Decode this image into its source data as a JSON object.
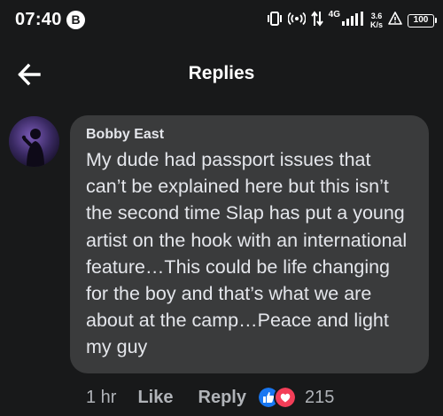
{
  "status_bar": {
    "time": "07:40",
    "b_badge": "B",
    "net_type": "4G",
    "speed_value": "3.6",
    "speed_unit": "K/s",
    "battery_level": "100",
    "icons": [
      "vibrate-icon",
      "hotspot-icon",
      "data-transfer-icon",
      "signal-icon",
      "warning-icon",
      "battery-icon"
    ]
  },
  "header": {
    "title": "Replies",
    "back_icon": "arrow-left-icon"
  },
  "comment": {
    "author": "Bobby East",
    "text": "My dude had passport issues that can’t be explained here but this isn’t the second time Slap has put a young artist on the hook with an international feature…This could be life changing for the boy and that’s what we are about at the camp…Peace and light my guy",
    "time": "1 hr",
    "like_label": "Like",
    "reply_label": "Reply",
    "reaction_icons": [
      "like-reaction-icon",
      "love-reaction-icon"
    ],
    "reaction_count": "215"
  },
  "colors": {
    "background": "#18191a",
    "bubble": "#3a3b3c",
    "text_primary": "#e4e6eb",
    "text_secondary": "#b0b3b8",
    "like_blue": "#1877f2",
    "love_red": "#f33e58"
  }
}
